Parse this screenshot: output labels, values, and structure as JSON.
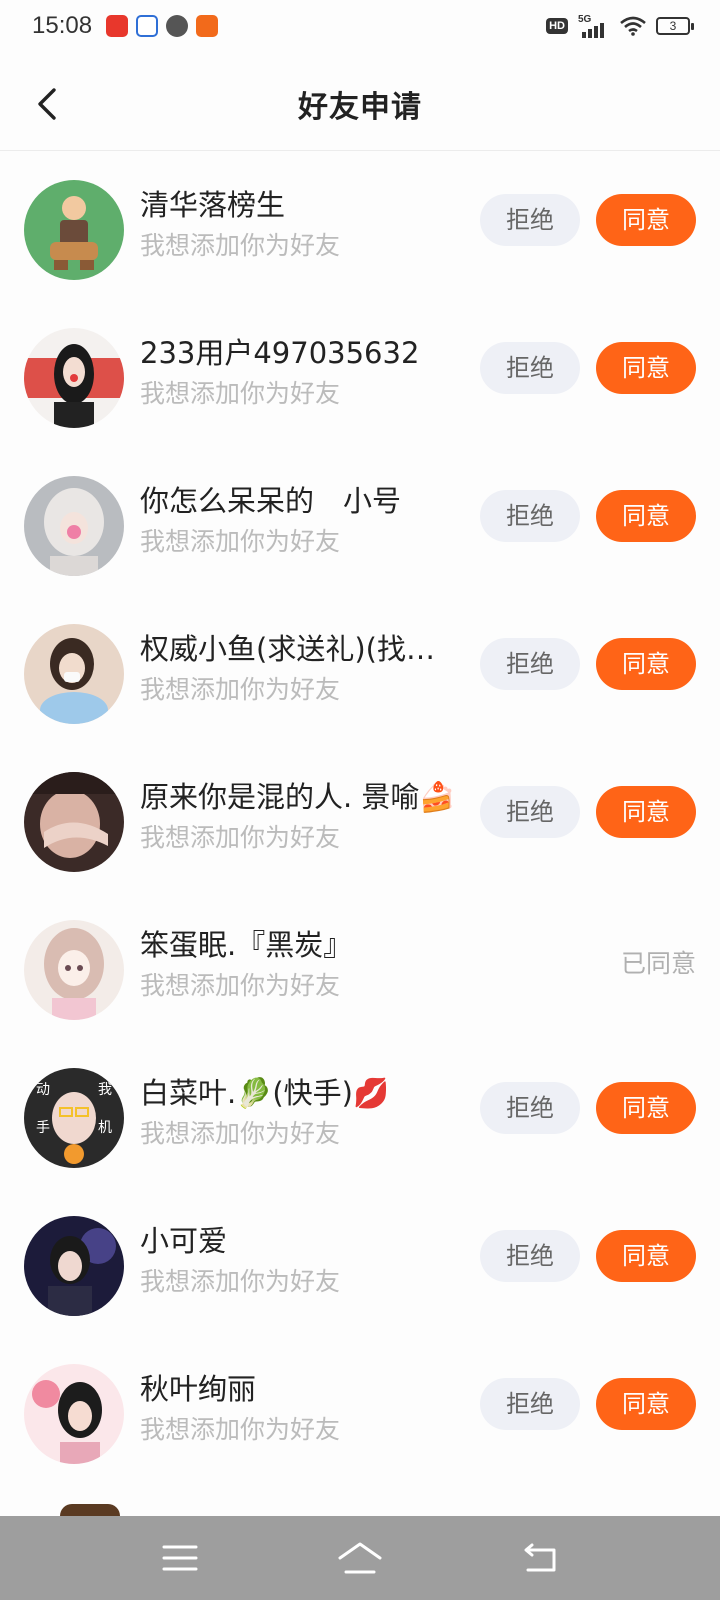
{
  "status_bar": {
    "time": "15:08",
    "network": "5G",
    "hd_badge": "HD",
    "battery": "3"
  },
  "header": {
    "title": "好友申请",
    "back_icon": "chevron-left-icon"
  },
  "labels": {
    "reject": "拒绝",
    "accept": "同意",
    "accepted": "已同意"
  },
  "requests": [
    {
      "name": "清华落榜生",
      "message": "我想添加你为好友",
      "status": "pending"
    },
    {
      "name": "233用户497035632",
      "message": "我想添加你为好友",
      "status": "pending"
    },
    {
      "name": "你怎么呆呆的　小号",
      "message": "我想添加你为好友",
      "status": "pending"
    },
    {
      "name": "权威小鱼(求送礼)(找…",
      "message": "我想添加你为好友",
      "status": "pending"
    },
    {
      "name": "原来你是混的人. 景喻🍰",
      "message": "我想添加你为好友",
      "status": "pending"
    },
    {
      "name": "笨蛋眠.『黑炭』",
      "message": "我想添加你为好友",
      "status": "accepted"
    },
    {
      "name": "白菜叶.🥬(快手)💋",
      "message": "我想添加你为好友",
      "status": "pending"
    },
    {
      "name": "小可爱",
      "message": "我想添加你为好友",
      "status": "pending"
    },
    {
      "name": "秋叶绚丽",
      "message": "我想添加你为好友",
      "status": "pending"
    }
  ],
  "nav_bar": {
    "menu_icon": "menu-icon",
    "home_icon": "home-icon",
    "back_icon": "back-arrow-icon"
  },
  "colors": {
    "accent": "#ff6417",
    "reject_bg": "#eef0f6",
    "hint_text": "#bbbbbb"
  }
}
